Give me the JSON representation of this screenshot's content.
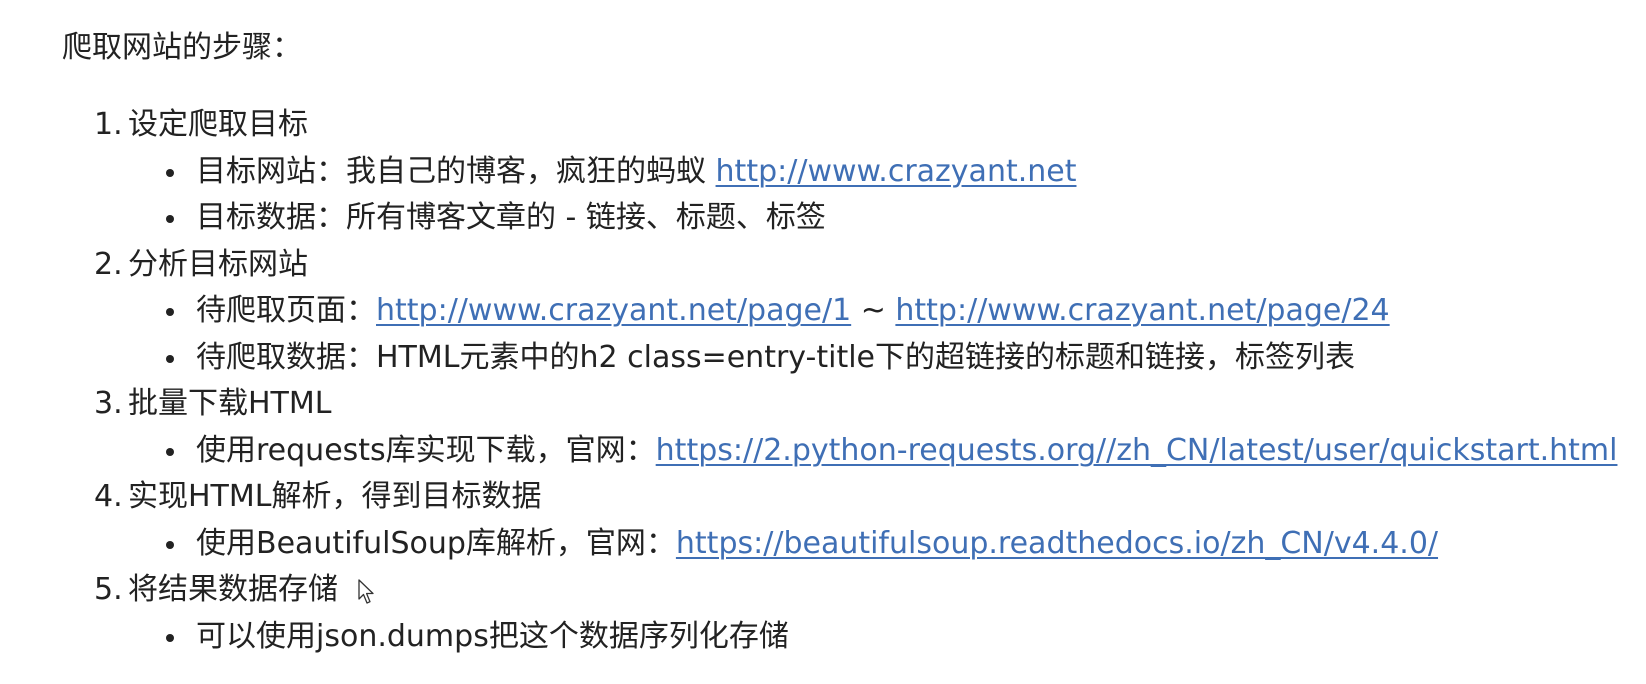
{
  "heading": "爬取网站的步骤：",
  "steps": [
    {
      "num": "1.",
      "title": "设定爬取目标",
      "items": [
        {
          "text": "目标网站：我自己的博客，疯狂的蚂蚁 ",
          "link": "http://www.crazyant.net"
        },
        {
          "text": "目标数据：所有博客文章的 - 链接、标题、标签"
        }
      ]
    },
    {
      "num": "2.",
      "title": "分析目标网站",
      "items": [
        {
          "text": "待爬取页面：",
          "link": "http://www.crazyant.net/page/1",
          "sep": " ~ ",
          "link2": "http://www.crazyant.net/page/24"
        },
        {
          "text": "待爬取数据：HTML元素中的h2 class=entry-title下的超链接的标题和链接，标签列表"
        }
      ]
    },
    {
      "num": "3.",
      "title": "批量下载HTML",
      "items": [
        {
          "text": "使用requests库实现下载，官网：",
          "link": "https://2.python-requests.org//zh_CN/latest/user/quickstart.html"
        }
      ]
    },
    {
      "num": "4.",
      "title": "实现HTML解析，得到目标数据",
      "items": [
        {
          "text": "使用BeautifulSoup库解析，官网：",
          "link": "https://beautifulsoup.readthedocs.io/zh_CN/v4.4.0/"
        }
      ]
    },
    {
      "num": "5.",
      "title": "将结果数据存储",
      "items": [
        {
          "text": "可以使用json.dumps把这个数据序列化存储"
        }
      ]
    }
  ],
  "icons": {
    "cursor": "mouse-pointer-icon"
  },
  "colors": {
    "text": "#222222",
    "link": "#3f6fb5",
    "background": "#ffffff"
  }
}
